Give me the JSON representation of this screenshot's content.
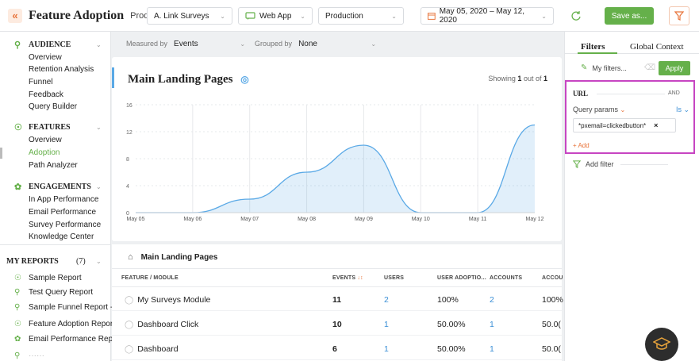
{
  "header": {
    "title": "Feature Adoption",
    "product_label": "Product",
    "product_value": "A. Link Surveys",
    "app_value": "Web App",
    "env_value": "Production",
    "date_range": "May 05, 2020 – May 12, 2020",
    "save_label": "Save as..."
  },
  "sidebar": {
    "audience": {
      "label": "AUDIENCE",
      "items": [
        "Overview",
        "Retention Analysis",
        "Funnel",
        "Feedback",
        "Query Builder"
      ]
    },
    "features": {
      "label": "FEATURES",
      "items": [
        "Overview",
        "Adoption",
        "Path Analyzer"
      ],
      "active": "Adoption"
    },
    "engagements": {
      "label": "ENGAGEMENTS",
      "items": [
        "In App Performance",
        "Email Performance",
        "Survey Performance",
        "Knowledge Center"
      ]
    },
    "my_reports": {
      "label": "MY REPORTS",
      "count": "(7)",
      "items": [
        "Sample Report",
        "Test Query Report",
        "Sample Funnel Report - ...",
        "Feature Adoption Report",
        "Email Performance Rep..."
      ]
    }
  },
  "controls": {
    "measured_by_label": "Measured by",
    "measured_by_value": "Events",
    "grouped_by_label": "Grouped by",
    "grouped_by_value": "None"
  },
  "chart": {
    "title": "Main Landing Pages",
    "showing_prefix": "Showing",
    "showing_count": "1",
    "showing_mid": "out of",
    "showing_total": "1"
  },
  "chart_data": {
    "type": "area",
    "x": [
      "May 05",
      "May 06",
      "May 07",
      "May 08",
      "May 09",
      "May 10",
      "May 11",
      "May 12"
    ],
    "y_ticks": [
      0,
      4,
      8,
      12,
      16
    ],
    "ylim": [
      0,
      16
    ],
    "series": [
      {
        "values": [
          0,
          0,
          2,
          6,
          10,
          0,
          0,
          13
        ]
      }
    ],
    "grid": true,
    "color": "#5aa9e6"
  },
  "table": {
    "title": "Main Landing Pages",
    "columns": [
      "FEATURE / MODULE",
      "EVENTS",
      "USERS",
      "USER ADOPTIO...",
      "ACCOUNTS",
      "ACCOU"
    ],
    "rows": [
      {
        "name": "My Surveys Module",
        "events": "11",
        "users": "2",
        "adoption": "100%",
        "accounts": "2",
        "acc_pct": "100%"
      },
      {
        "name": "Dashboard Click",
        "events": "10",
        "users": "1",
        "adoption": "50.00%",
        "accounts": "1",
        "acc_pct": "50.0("
      },
      {
        "name": "Dashboard",
        "events": "6",
        "users": "1",
        "adoption": "50.00%",
        "accounts": "1",
        "acc_pct": "50.0("
      }
    ]
  },
  "filters_panel": {
    "tab_filters": "Filters",
    "tab_global": "Global Context",
    "my_filters": "My filters...",
    "apply": "Apply",
    "url_label": "URL",
    "and_label": "AND",
    "query_params": "Query params",
    "is_label": "Is",
    "chip_value": "*pxemail=clickedbutton*",
    "add_label": "+ Add",
    "add_filter": "Add filter"
  },
  "colors": {
    "accent_green": "#65b04a",
    "accent_orange": "#e8743b",
    "link_blue": "#3b8fd6",
    "highlight": "#c745c2"
  }
}
